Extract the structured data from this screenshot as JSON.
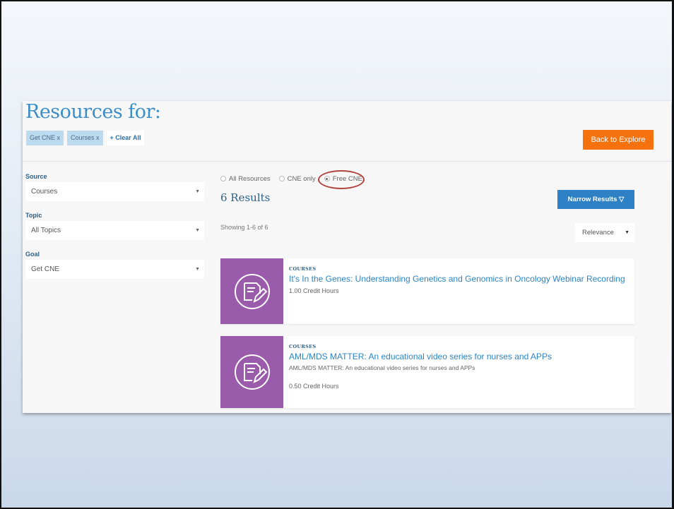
{
  "page": {
    "title": "Resources for:"
  },
  "chips": [
    {
      "label": "Get CNE x"
    },
    {
      "label": "Courses x"
    }
  ],
  "clear_all_label": "+ Clear All",
  "back_button_label": "Back to Explore",
  "filters": {
    "source": {
      "label": "Source",
      "value": "Courses"
    },
    "topic": {
      "label": "Topic",
      "value": "All Topics"
    },
    "goal": {
      "label": "Goal",
      "value": "Get CNE"
    }
  },
  "radios": {
    "all": "All Resources",
    "cne_only": "CNE only",
    "free_cne": "Free CNE",
    "selected": "Free CNE"
  },
  "results": {
    "count_label": "6 Results",
    "showing_label": "Showing 1-6 of 6",
    "narrow_label": "Narrow Results ▽",
    "sort_value": "Relevance"
  },
  "cards": [
    {
      "type": "COURSES",
      "title": "It's In the Genes: Understanding Genetics and Genomics in Oncology Webinar Recording",
      "description": "",
      "hours": "1.00 Credit Hours"
    },
    {
      "type": "COURSES",
      "title": "AML/MDS MATTER: An educational video series for nurses and APPs",
      "description": "AML/MDS MATTER: An educational video series for nurses and APPs",
      "hours": "0.50 Credit Hours"
    }
  ],
  "colors": {
    "accent_blue": "#2e81c4",
    "title_blue": "#3d8ec6",
    "orange": "#f6720f",
    "thumb_purple": "#9b5bab",
    "highlight_red": "#b0433b"
  },
  "icons": {
    "card_thumb": "pencil-document-icon",
    "select_caret": "caret-down-icon"
  }
}
